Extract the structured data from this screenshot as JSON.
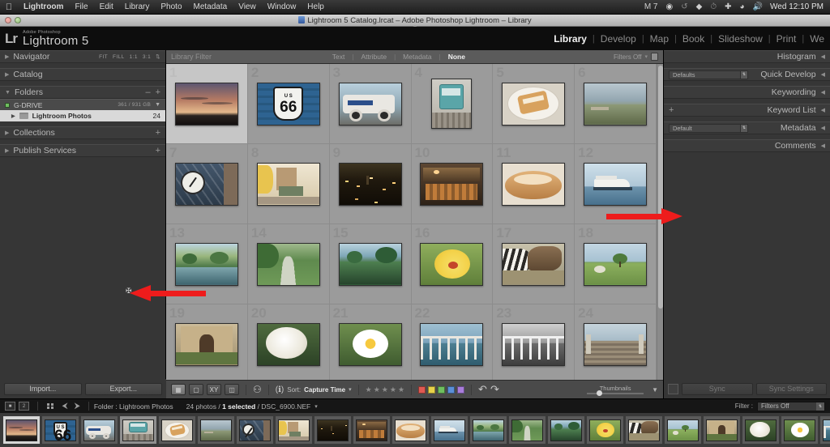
{
  "os_menu": {
    "apple_icon": "apple-icon",
    "items": [
      "Lightroom",
      "File",
      "Edit",
      "Library",
      "Photo",
      "Metadata",
      "View",
      "Window",
      "Help"
    ],
    "status_items": [
      "M 7",
      "bluetooth-icon",
      "sync-icon",
      "dropbox-icon",
      "timemachine-icon",
      "airplay-icon",
      "wifi-icon",
      "volume-icon"
    ],
    "clock": "Wed 12:10 PM"
  },
  "window": {
    "title": "Lightroom 5 Catalog.lrcat – Adobe Photoshop Lightroom – Library",
    "close_button": "close-button",
    "minimize_button": "minimize-button"
  },
  "identity": {
    "mark": "Lr",
    "superscript": "Adobe Photoshop",
    "name": "Lightroom 5"
  },
  "modules": {
    "items": [
      "Library",
      "Develop",
      "Map",
      "Book",
      "Slideshow",
      "Print",
      "We"
    ],
    "active": "Library"
  },
  "left_panel": {
    "navigator": {
      "title": "Navigator",
      "zoom_fit": "FIT",
      "zoom_fill": "FILL",
      "zoom_1_1": "1:1",
      "zoom_3_1": "3:1"
    },
    "catalog": {
      "title": "Catalog"
    },
    "folders": {
      "title": "Folders",
      "volume": "G-DRIVE",
      "volume_capacity": "361 / 931 GB",
      "folder_name": "Lightroom Photos",
      "folder_count": "24"
    },
    "collections": {
      "title": "Collections"
    },
    "publish_services": {
      "title": "Publish Services"
    },
    "import_button": "Import...",
    "export_button": "Export..."
  },
  "right_panel": {
    "histogram": {
      "title": "Histogram"
    },
    "quick_develop": {
      "title": "Quick Develop",
      "preset": "Defaults"
    },
    "keywording": {
      "title": "Keywording"
    },
    "keyword_list": {
      "title": "Keyword List",
      "add": "+"
    },
    "metadata": {
      "title": "Metadata",
      "preset": "Default"
    },
    "comments": {
      "title": "Comments"
    },
    "sync_button": "Sync",
    "sync_settings_button": "Sync Settings"
  },
  "library_filter": {
    "label": "Library Filter",
    "tabs": [
      "Text",
      "Attribute",
      "Metadata",
      "None"
    ],
    "active_tab": "None",
    "filters_state": "Filters Off",
    "lock_icon": "lock-icon"
  },
  "toolbar": {
    "view_grid": "grid-view-icon",
    "view_loupe": "loupe-view-icon",
    "view_compare": "compare-view-icon",
    "view_survey": "survey-view-icon",
    "painter": "painter-spray-icon",
    "sort_direction": "az-sort-icon",
    "sort_label": "Sort:",
    "sort_value": "Capture Time",
    "rating_stars": 5,
    "color_labels": [
      "#e05a52",
      "#e8d24a",
      "#6fbf5f",
      "#5b8fd8",
      "#a97ddb"
    ],
    "rotate_left": "rotate-left-icon",
    "rotate_right": "rotate-right-icon",
    "thumbnails_label": "Thumbnails",
    "thumbnails_value": 18,
    "toolbar_caret": "chevron-down-icon"
  },
  "filmstrip_bar": {
    "back_icon": "navigate-back-icon",
    "forward_icon": "navigate-forward-icon",
    "second_window_icon": "second-window-icon",
    "grid_icon": "filmstrip-grid-icon",
    "folder_label": "Folder : Lightroom Photos",
    "count_prefix": "24 photos / ",
    "count_selected": "1 selected",
    "count_suffix": " / DSC_6900.NEF",
    "caret": "chevron-down-icon",
    "filter_label": "Filter :",
    "filter_value": "Filters Off"
  },
  "grid": {
    "cells": [
      {
        "index": "1",
        "name": "sunset-clouds-silhouette",
        "selected": true
      },
      {
        "index": "2",
        "name": "route-66-sign",
        "selected": false
      },
      {
        "index": "3",
        "name": "vintage-fire-truck",
        "selected": false
      },
      {
        "index": "4",
        "name": "teal-train-car",
        "selected": false
      },
      {
        "index": "5",
        "name": "dessert-on-plate",
        "selected": false
      },
      {
        "index": "6",
        "name": "coastal-hillside",
        "selected": false
      },
      {
        "index": "7",
        "name": "station-clock",
        "selected": false
      },
      {
        "index": "8",
        "name": "street-cafe-awning",
        "selected": false
      },
      {
        "index": "9",
        "name": "city-night-lights",
        "selected": false
      },
      {
        "index": "10",
        "name": "market-hall-interior",
        "selected": false
      },
      {
        "index": "11",
        "name": "pastry-closeup",
        "selected": false
      },
      {
        "index": "12",
        "name": "ferry-boat-harbor",
        "selected": false
      },
      {
        "index": "13",
        "name": "tropical-canal-resort",
        "selected": false
      },
      {
        "index": "14",
        "name": "garden-path",
        "selected": false
      },
      {
        "index": "15",
        "name": "palm-tree-coast",
        "selected": false
      },
      {
        "index": "16",
        "name": "yellow-hibiscus-flower",
        "selected": false
      },
      {
        "index": "17",
        "name": "zebra-and-donkey",
        "selected": false
      },
      {
        "index": "18",
        "name": "green-field-tree",
        "selected": false
      },
      {
        "index": "19",
        "name": "stone-villa-garden",
        "selected": false
      },
      {
        "index": "20",
        "name": "white-rose",
        "selected": false
      },
      {
        "index": "21",
        "name": "white-daisy",
        "selected": false
      },
      {
        "index": "22",
        "name": "pier-railing-color",
        "selected": false
      },
      {
        "index": "23",
        "name": "pier-railing-bw",
        "selected": false
      },
      {
        "index": "24",
        "name": "boardwalk-pier",
        "selected": false
      }
    ]
  },
  "annotations": {
    "left_arrow": "red-arrow-pointing-left",
    "right_arrow": "red-arrow-pointing-right",
    "cursor": "mouse-cursor"
  },
  "colors": {
    "panel_bg": "#363636",
    "grid_bg": "#9b9b9b",
    "accent_red": "#ee1c1c",
    "text_light": "#b8b8b8"
  }
}
